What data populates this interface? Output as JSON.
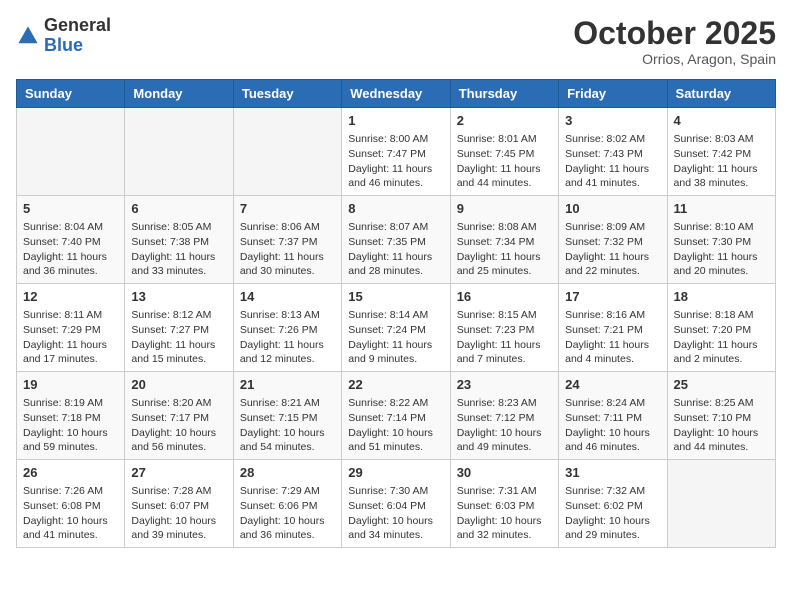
{
  "header": {
    "logo_general": "General",
    "logo_blue": "Blue",
    "title": "October 2025",
    "subtitle": "Orrios, Aragon, Spain"
  },
  "days_of_week": [
    "Sunday",
    "Monday",
    "Tuesday",
    "Wednesday",
    "Thursday",
    "Friday",
    "Saturday"
  ],
  "weeks": [
    [
      {
        "day": "",
        "info": ""
      },
      {
        "day": "",
        "info": ""
      },
      {
        "day": "",
        "info": ""
      },
      {
        "day": "1",
        "info": "Sunrise: 8:00 AM\nSunset: 7:47 PM\nDaylight: 11 hours and 46 minutes."
      },
      {
        "day": "2",
        "info": "Sunrise: 8:01 AM\nSunset: 7:45 PM\nDaylight: 11 hours and 44 minutes."
      },
      {
        "day": "3",
        "info": "Sunrise: 8:02 AM\nSunset: 7:43 PM\nDaylight: 11 hours and 41 minutes."
      },
      {
        "day": "4",
        "info": "Sunrise: 8:03 AM\nSunset: 7:42 PM\nDaylight: 11 hours and 38 minutes."
      }
    ],
    [
      {
        "day": "5",
        "info": "Sunrise: 8:04 AM\nSunset: 7:40 PM\nDaylight: 11 hours and 36 minutes."
      },
      {
        "day": "6",
        "info": "Sunrise: 8:05 AM\nSunset: 7:38 PM\nDaylight: 11 hours and 33 minutes."
      },
      {
        "day": "7",
        "info": "Sunrise: 8:06 AM\nSunset: 7:37 PM\nDaylight: 11 hours and 30 minutes."
      },
      {
        "day": "8",
        "info": "Sunrise: 8:07 AM\nSunset: 7:35 PM\nDaylight: 11 hours and 28 minutes."
      },
      {
        "day": "9",
        "info": "Sunrise: 8:08 AM\nSunset: 7:34 PM\nDaylight: 11 hours and 25 minutes."
      },
      {
        "day": "10",
        "info": "Sunrise: 8:09 AM\nSunset: 7:32 PM\nDaylight: 11 hours and 22 minutes."
      },
      {
        "day": "11",
        "info": "Sunrise: 8:10 AM\nSunset: 7:30 PM\nDaylight: 11 hours and 20 minutes."
      }
    ],
    [
      {
        "day": "12",
        "info": "Sunrise: 8:11 AM\nSunset: 7:29 PM\nDaylight: 11 hours and 17 minutes."
      },
      {
        "day": "13",
        "info": "Sunrise: 8:12 AM\nSunset: 7:27 PM\nDaylight: 11 hours and 15 minutes."
      },
      {
        "day": "14",
        "info": "Sunrise: 8:13 AM\nSunset: 7:26 PM\nDaylight: 11 hours and 12 minutes."
      },
      {
        "day": "15",
        "info": "Sunrise: 8:14 AM\nSunset: 7:24 PM\nDaylight: 11 hours and 9 minutes."
      },
      {
        "day": "16",
        "info": "Sunrise: 8:15 AM\nSunset: 7:23 PM\nDaylight: 11 hours and 7 minutes."
      },
      {
        "day": "17",
        "info": "Sunrise: 8:16 AM\nSunset: 7:21 PM\nDaylight: 11 hours and 4 minutes."
      },
      {
        "day": "18",
        "info": "Sunrise: 8:18 AM\nSunset: 7:20 PM\nDaylight: 11 hours and 2 minutes."
      }
    ],
    [
      {
        "day": "19",
        "info": "Sunrise: 8:19 AM\nSunset: 7:18 PM\nDaylight: 10 hours and 59 minutes."
      },
      {
        "day": "20",
        "info": "Sunrise: 8:20 AM\nSunset: 7:17 PM\nDaylight: 10 hours and 56 minutes."
      },
      {
        "day": "21",
        "info": "Sunrise: 8:21 AM\nSunset: 7:15 PM\nDaylight: 10 hours and 54 minutes."
      },
      {
        "day": "22",
        "info": "Sunrise: 8:22 AM\nSunset: 7:14 PM\nDaylight: 10 hours and 51 minutes."
      },
      {
        "day": "23",
        "info": "Sunrise: 8:23 AM\nSunset: 7:12 PM\nDaylight: 10 hours and 49 minutes."
      },
      {
        "day": "24",
        "info": "Sunrise: 8:24 AM\nSunset: 7:11 PM\nDaylight: 10 hours and 46 minutes."
      },
      {
        "day": "25",
        "info": "Sunrise: 8:25 AM\nSunset: 7:10 PM\nDaylight: 10 hours and 44 minutes."
      }
    ],
    [
      {
        "day": "26",
        "info": "Sunrise: 7:26 AM\nSunset: 6:08 PM\nDaylight: 10 hours and 41 minutes."
      },
      {
        "day": "27",
        "info": "Sunrise: 7:28 AM\nSunset: 6:07 PM\nDaylight: 10 hours and 39 minutes."
      },
      {
        "day": "28",
        "info": "Sunrise: 7:29 AM\nSunset: 6:06 PM\nDaylight: 10 hours and 36 minutes."
      },
      {
        "day": "29",
        "info": "Sunrise: 7:30 AM\nSunset: 6:04 PM\nDaylight: 10 hours and 34 minutes."
      },
      {
        "day": "30",
        "info": "Sunrise: 7:31 AM\nSunset: 6:03 PM\nDaylight: 10 hours and 32 minutes."
      },
      {
        "day": "31",
        "info": "Sunrise: 7:32 AM\nSunset: 6:02 PM\nDaylight: 10 hours and 29 minutes."
      },
      {
        "day": "",
        "info": ""
      }
    ]
  ]
}
